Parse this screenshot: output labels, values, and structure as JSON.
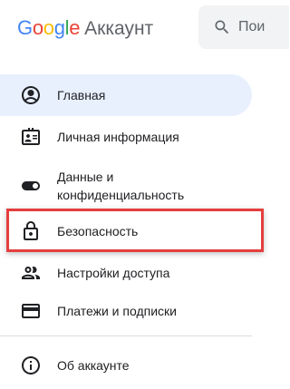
{
  "header": {
    "logo_word": "Google",
    "logo_letters": [
      {
        "ch": "G",
        "color": "#4285F4"
      },
      {
        "ch": "o",
        "color": "#EA4335"
      },
      {
        "ch": "o",
        "color": "#FBBC05"
      },
      {
        "ch": "g",
        "color": "#4285F4"
      },
      {
        "ch": "l",
        "color": "#34A853"
      },
      {
        "ch": "e",
        "color": "#EA4335"
      }
    ],
    "product": "Аккаунт"
  },
  "search": {
    "placeholder": "Пои",
    "icon": "search-icon"
  },
  "nav": {
    "items": [
      {
        "label": "Главная",
        "icon": "account-circle-icon",
        "active": true
      },
      {
        "label": "Личная информация",
        "icon": "id-card-icon"
      },
      {
        "label": "Данные и конфиденциальность",
        "icon": "toggle-icon"
      },
      {
        "label": "Безопасность",
        "icon": "lock-icon"
      },
      {
        "label": "Настройки доступа",
        "icon": "people-icon"
      },
      {
        "label": "Платежи и подписки",
        "icon": "credit-card-icon"
      }
    ],
    "about": {
      "label": "Об аккаунте",
      "icon": "info-icon"
    }
  },
  "colors": {
    "active_bg": "#e8f0fe",
    "highlight_border": "#e53e3e",
    "search_bg": "#f1f3f4"
  }
}
